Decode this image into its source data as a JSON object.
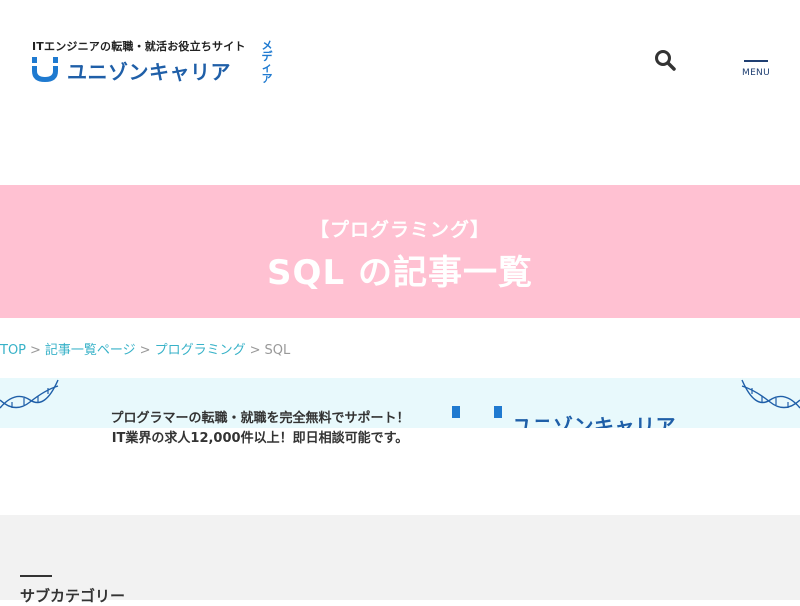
{
  "header": {
    "tagline": "ITエンジニアの転職・就活お役立ちサイト",
    "logo_name": "ユニゾンキャリア",
    "logo_media": "メディア",
    "brand_color": "#1f5fa8",
    "search_icon": "search-icon",
    "menu_label": "MENU"
  },
  "hero": {
    "background": "#ffc1d2",
    "category": "【プログラミング】",
    "title": "SQL の記事一覧"
  },
  "breadcrumb": {
    "items": [
      "TOP",
      "記事一覧ページ",
      "プログラミング"
    ],
    "separator": ">",
    "current": "SQL"
  },
  "banner": {
    "line1": "プログラマーの転職・就職を完全無料でサポート！",
    "line2": "IT業界の求人12,000件以上！即日相談可能です。",
    "logo_name": "ユニゾンキャリア"
  },
  "subcategory": {
    "heading": "サブカテゴリー"
  }
}
